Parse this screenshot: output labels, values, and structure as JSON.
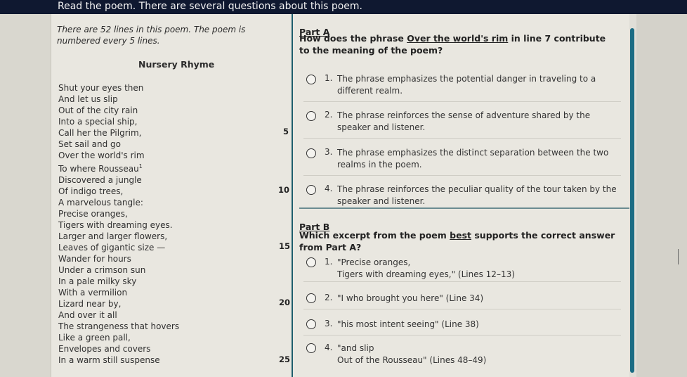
{
  "header": {
    "title": "Read the poem. There are several questions about this poem."
  },
  "intro": "There are 52 lines in this poem. The poem is numbered every 5 lines.",
  "poem": {
    "title": "Nursery Rhyme",
    "lines": [
      "Shut your eyes then",
      "And let us slip",
      "Out of the city rain",
      "Into a special ship,",
      "Call her the Pilgrim,",
      "Set sail and go",
      "Over the world's rim",
      "To where Rousseau",
      "Discovered a jungle",
      "Of indigo trees,",
      "A marvelous tangle:",
      "Precise oranges,",
      "Tigers with dreaming eyes.",
      "Larger and larger flowers,",
      "Leaves of gigantic size —",
      "Wander for hours",
      "Under a crimson sun",
      "In a pale milky sky",
      "With a vermilion",
      "Lizard near by,",
      "And over it all",
      "The strangeness that hovers",
      "Like a green pall,",
      "Envelopes and covers",
      "In a warm still suspense"
    ],
    "footnote_mark": "1",
    "line_numbers": [
      "5",
      "10",
      "15",
      "20",
      "25"
    ]
  },
  "partA": {
    "label": "Part A",
    "question_pre": "How does the phrase ",
    "question_phrase": "Over the world's rim",
    "question_post": " in line 7 contribute to the meaning of the poem?",
    "choices": [
      {
        "num": "1.",
        "text": "The phrase emphasizes the potential danger in traveling to a different realm."
      },
      {
        "num": "2.",
        "text": "The phrase reinforces the sense of adventure shared by the speaker and listener."
      },
      {
        "num": "3.",
        "text": "The phrase emphasizes the distinct separation between the two realms in the poem."
      },
      {
        "num": "4.",
        "text": "The phrase reinforces the peculiar quality of the tour taken by the speaker and listener."
      }
    ]
  },
  "partB": {
    "label": "Part B",
    "question_pre": "Which excerpt from the poem ",
    "question_best": "best",
    "question_post": " supports the correct answer from Part A?",
    "choices": [
      {
        "num": "1.",
        "line1": "\"Precise oranges,",
        "line2": "Tigers with dreaming eyes,\" (Lines 12–13)"
      },
      {
        "num": "2.",
        "line1": "\"I who brought you here\" (Line 34)",
        "line2": ""
      },
      {
        "num": "3.",
        "line1": "\"his most intent seeing\" (Line 38)",
        "line2": ""
      },
      {
        "num": "4.",
        "line1": "\"and slip",
        "line2": "Out of the Rousseau\" (Lines 48–49)"
      }
    ]
  }
}
